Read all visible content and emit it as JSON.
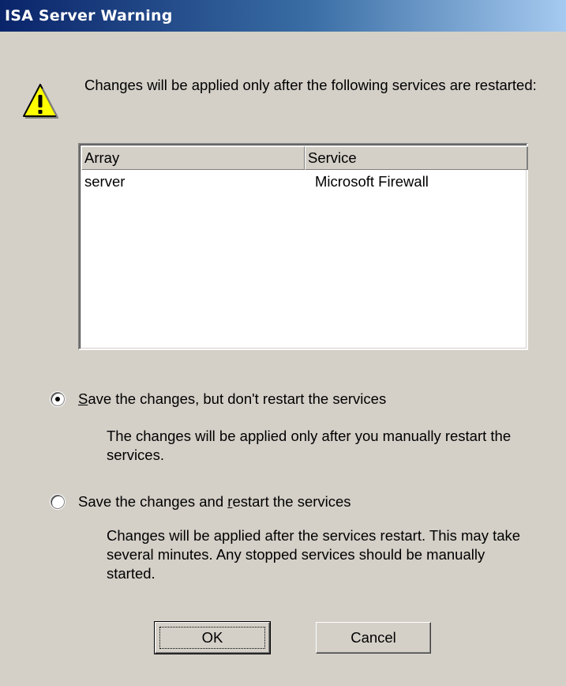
{
  "window": {
    "title": "ISA Server Warning"
  },
  "message": {
    "text": "Changes will be applied only after the following services are restarted:"
  },
  "icons": {
    "warning": "warning-triangle-icon"
  },
  "services_table": {
    "columns": [
      "Array",
      "Service"
    ],
    "rows": [
      {
        "array": "server",
        "service": "Microsoft Firewall"
      }
    ]
  },
  "options": [
    {
      "mnemonic": "S",
      "label_rest": "ave the changes, but don't restart the services",
      "selected": true,
      "description": "The changes will be applied only after you manually restart the services."
    },
    {
      "label_before": "Save the changes and ",
      "mnemonic": "r",
      "label_after": "estart the services",
      "selected": false,
      "description": "Changes will be applied after the services restart. This may take several minutes. Any stopped services should be manually started."
    }
  ],
  "buttons": {
    "ok": "OK",
    "cancel": "Cancel"
  },
  "colors": {
    "dialog_bg": "#d4d0c8",
    "title_start": "#0a246a",
    "title_end": "#a6caf0",
    "warning_yellow": "#ffff00"
  }
}
